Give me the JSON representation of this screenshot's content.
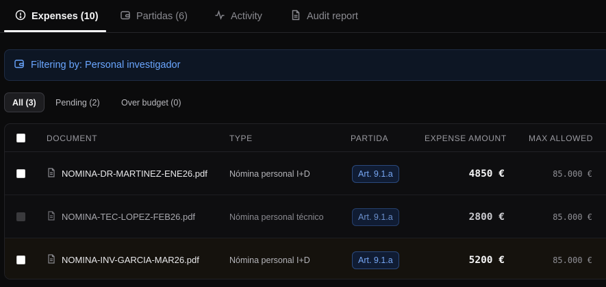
{
  "tabs": [
    {
      "label": "Expenses (10)",
      "icon": "alert-circle-icon",
      "active": true
    },
    {
      "label": "Partidas (6)",
      "icon": "wallet-icon",
      "active": false
    },
    {
      "label": "Activity",
      "icon": "activity-icon",
      "active": false
    },
    {
      "label": "Audit report",
      "icon": "document-icon",
      "active": false
    }
  ],
  "filter_banner": {
    "text": "Filtering by: Personal investigador",
    "icon": "wallet-icon",
    "color": "#6aa6ff"
  },
  "filters": [
    {
      "label": "All (3)",
      "active": true
    },
    {
      "label": "Pending (2)",
      "active": false
    },
    {
      "label": "Over budget (0)",
      "active": false
    }
  ],
  "table": {
    "columns": [
      "DOCUMENT",
      "TYPE",
      "PARTIDA",
      "EXPENSE AMOUNT",
      "MAX ALLOWED"
    ],
    "rows": [
      {
        "document": "NOMINA-DR-MARTINEZ-ENE26.pdf",
        "type": "Nómina personal I+D",
        "partida": "Art. 9.1.a",
        "amount": "4850 €",
        "max_allowed": "85.000 €",
        "checked": false,
        "disabled": false,
        "muted": false,
        "highlight": false
      },
      {
        "document": "NOMINA-TEC-LOPEZ-FEB26.pdf",
        "type": "Nómina personal técnico",
        "partida": "Art. 9.1.a",
        "amount": "2800 €",
        "max_allowed": "85.000 €",
        "checked": false,
        "disabled": true,
        "muted": true,
        "highlight": false
      },
      {
        "document": "NOMINA-INV-GARCIA-MAR26.pdf",
        "type": "Nómina personal I+D",
        "partida": "Art. 9.1.a",
        "amount": "5200 €",
        "max_allowed": "85.000 €",
        "checked": false,
        "disabled": false,
        "muted": false,
        "highlight": true
      }
    ]
  },
  "colors": {
    "accent": "#6aa6ff",
    "badge_text": "#78a8f5",
    "highlight_row": "#15120d"
  }
}
